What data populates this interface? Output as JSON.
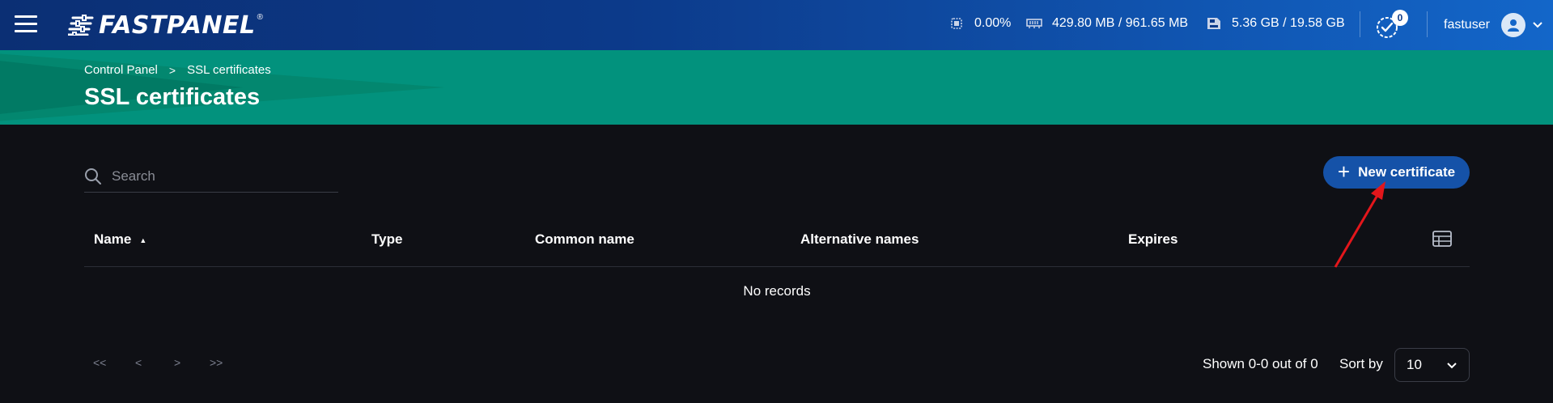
{
  "app": {
    "name": "FASTPANEL",
    "reg_mark": "®"
  },
  "topbar": {
    "cpu": {
      "icon": "cpu-icon",
      "value": "0.00%"
    },
    "ram": {
      "icon": "memory-icon",
      "value": "429.80 MB / 961.65 MB"
    },
    "disk": {
      "icon": "disk-icon",
      "value": "5.36 GB / 19.58 GB"
    },
    "tasks": {
      "icon": "tasks-check-icon",
      "count": "0"
    },
    "user": {
      "name": "fastuser",
      "icon": "user-avatar-icon"
    }
  },
  "breadcrumb": {
    "root": "Control Panel",
    "separator": ">",
    "current": "SSL certificates"
  },
  "page": {
    "title": "SSL certificates"
  },
  "search": {
    "placeholder": "Search",
    "value": ""
  },
  "actions": {
    "new_certificate": "New certificate"
  },
  "table": {
    "columns": [
      "Name",
      "Type",
      "Common name",
      "Alternative names",
      "Expires"
    ],
    "sort_indicator": "▲",
    "empty_text": "No records"
  },
  "pagination": {
    "first": "<<",
    "prev": "<",
    "next": ">",
    "last": ">>",
    "shown_text": "Shown 0-0 out of 0",
    "sort_by_label": "Sort by",
    "page_size": "10"
  },
  "colors": {
    "topbar_start": "#0b2f74",
    "topbar_end": "#1366c9",
    "header_band": "#02927d",
    "background": "#0f1015",
    "primary_button": "#1552a8",
    "annotation_arrow": "#e3161b"
  }
}
